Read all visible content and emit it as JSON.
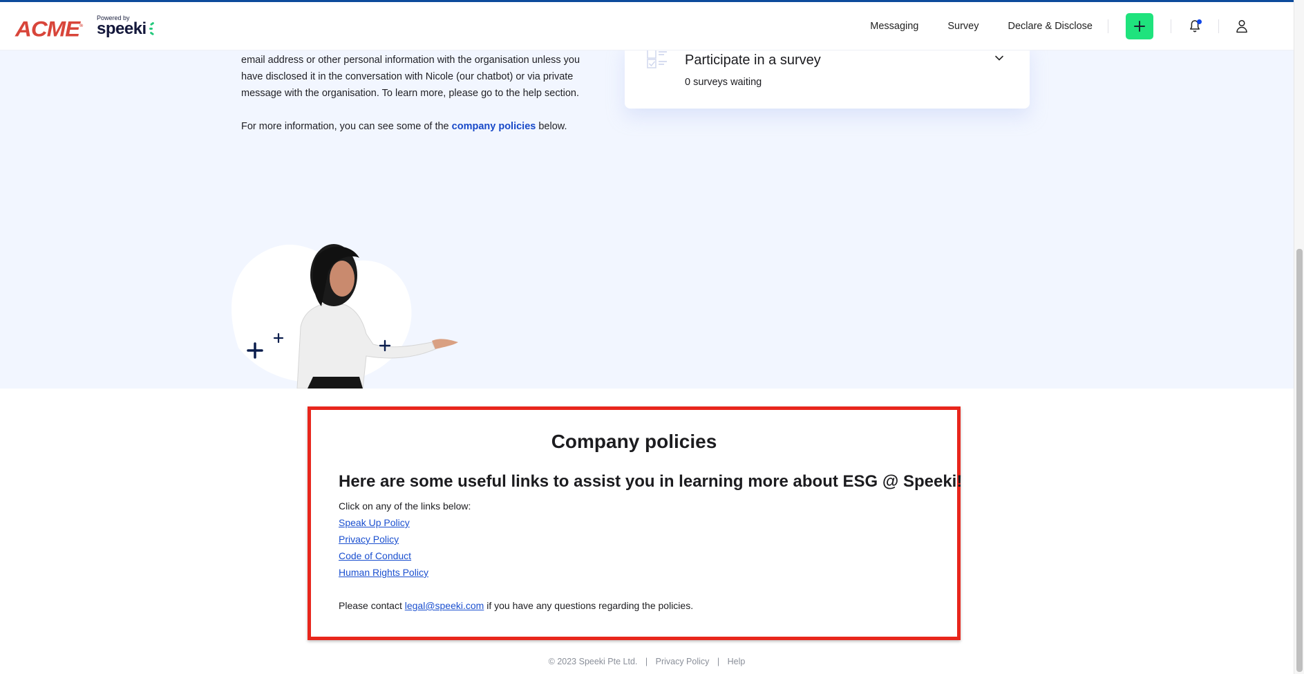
{
  "header": {
    "brand_logo": "ACME",
    "brand_mark": "®",
    "powered_by_label": "Powered by",
    "powered_by_brand": "speeki",
    "nav": [
      {
        "label": "Messaging"
      },
      {
        "label": "Survey"
      },
      {
        "label": "Declare & Disclose"
      }
    ],
    "icons": {
      "create": "plus-icon",
      "notifications": "bell-icon",
      "profile": "user-icon"
    },
    "notification_unread": true
  },
  "intro": {
    "paragraph1": "email address or other personal information with the organisation unless you have disclosed it in the conversation with Nicole (our chatbot) or via private message with the organisation. To learn more, please go to the help section.",
    "paragraph2_before": "For more information, you can see some of the ",
    "paragraph2_link": "company policies",
    "paragraph2_after": " below."
  },
  "survey_card": {
    "icon": "survey-checklist-icon",
    "title": "Participate in a survey",
    "subtitle": "0 surveys waiting",
    "expand_icon": "chevron-down-icon"
  },
  "illustration": {
    "description": "Nicole chatbot avatar presenting"
  },
  "policies": {
    "title": "Company policies",
    "subtitle": "Here are some useful links to assist you in learning more about ESG @ Speeki!",
    "instruction": "Click on any of the links below:",
    "links": [
      {
        "label": "Speak Up Policy"
      },
      {
        "label": "Privacy Policy"
      },
      {
        "label": "Code of Conduct"
      },
      {
        "label": "Human Rights Policy"
      }
    ],
    "contact_before": "Please contact ",
    "contact_email": "legal@speeki.com",
    "contact_after": " if you have any questions regarding the policies."
  },
  "footer": {
    "copyright": "© 2023 Speeki Pte Ltd.",
    "separator": "|",
    "links": [
      {
        "label": "Privacy Policy"
      },
      {
        "label": "Help"
      }
    ]
  },
  "colors": {
    "accent_green": "#1fe37d",
    "link_blue": "#1a4fcf",
    "highlight_red": "#e8261c",
    "brand_red": "#d8453a",
    "top_bar": "#0d4b9c",
    "hero_bg": "#f2f6ff"
  }
}
